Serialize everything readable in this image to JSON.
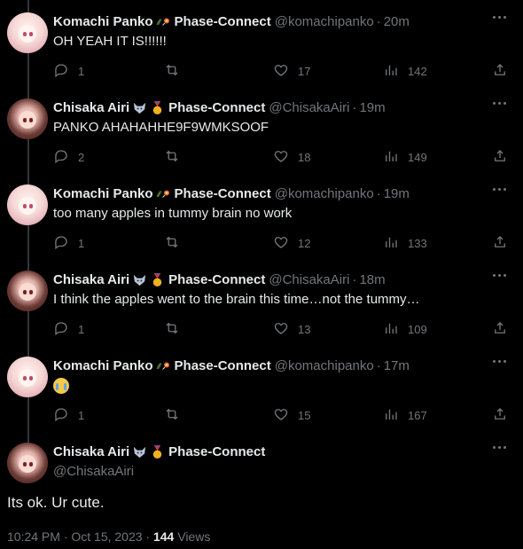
{
  "tweets": [
    {
      "author": "Komachi Panko",
      "org": "Phase-Connect",
      "handle": "@komachipanko",
      "time": "20m",
      "text": "OH YEAH IT IS!!!!!!",
      "replies": "1",
      "retweets": "",
      "likes": "17",
      "views": "142",
      "avatar": "panko",
      "emoji_text": false
    },
    {
      "author": "Chisaka Airi",
      "org": "Phase-Connect",
      "handle": "@ChisakaAiri",
      "time": "19m",
      "text": "PANKO AHAHAHHE9F9WMKSOOF",
      "replies": "2",
      "retweets": "",
      "likes": "18",
      "views": "149",
      "avatar": "airi",
      "emoji_text": false
    },
    {
      "author": "Komachi Panko",
      "org": "Phase-Connect",
      "handle": "@komachipanko",
      "time": "19m",
      "text": "too many apples in tummy brain no work",
      "replies": "1",
      "retweets": "",
      "likes": "12",
      "views": "133",
      "avatar": "panko",
      "emoji_text": false
    },
    {
      "author": "Chisaka Airi",
      "org": "Phase-Connect",
      "handle": "@ChisakaAiri",
      "time": "18m",
      "text": "I think the apples went to the brain this time…not the tummy…",
      "replies": "1",
      "retweets": "",
      "likes": "13",
      "views": "109",
      "avatar": "airi",
      "emoji_text": false
    },
    {
      "author": "Komachi Panko",
      "org": "Phase-Connect",
      "handle": "@komachipanko",
      "time": "17m",
      "text": "😭",
      "replies": "1",
      "retweets": "",
      "likes": "15",
      "views": "167",
      "avatar": "panko",
      "emoji_text": true
    }
  ],
  "main": {
    "author": "Chisaka Airi",
    "org": "Phase-Connect",
    "handle": "@ChisakaAiri",
    "text": "Its ok. Ur cute.",
    "timestamp": "10:24 PM · Oct 15, 2023 · ",
    "views_count": "144",
    "views_label": " Views"
  },
  "dot": "·",
  "icons": [
    "reply-icon",
    "retweet-icon",
    "like-icon",
    "views-icon",
    "share-icon",
    "more-icon"
  ],
  "colors": {
    "background": "#000000",
    "text": "#e7e9ea",
    "muted": "#71767b"
  }
}
